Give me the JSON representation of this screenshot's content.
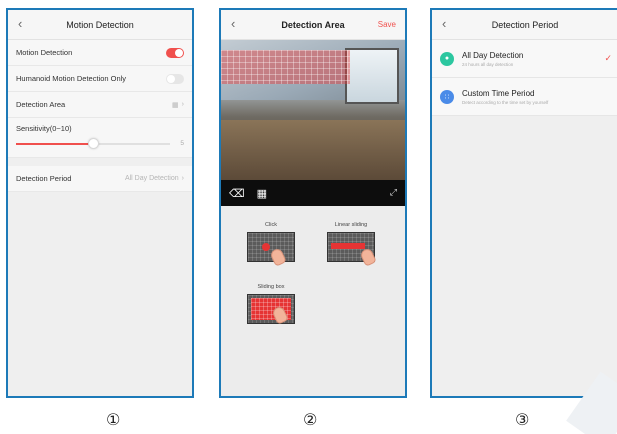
{
  "screen1": {
    "back_icon": "chevron-left",
    "title": "Motion Detection",
    "rows": {
      "motion_detection": "Motion Detection",
      "humanoid": "Humanoid Motion Detection Only",
      "detection_area": "Detection Area"
    },
    "motion_detection_on": true,
    "humanoid_on": false,
    "sensitivity_label": "Sensitivity(0~10)",
    "sensitivity_value": "5",
    "detection_period_label": "Detection Period",
    "detection_period_value": "All Day Detection",
    "accent_color": "#f0504d"
  },
  "screen2": {
    "back_icon": "chevron-left",
    "title": "Detection Area",
    "save_label": "Save",
    "demos": {
      "click": "Click",
      "linear": "Linear sliding",
      "box": "Sliding box"
    }
  },
  "screen3": {
    "back_icon": "chevron-left",
    "title": "Detection Period",
    "options": [
      {
        "title": "All Day Detection",
        "subtitle": "24 hours all day detection",
        "selected": true
      },
      {
        "title": "Custom Time Period",
        "subtitle": "Detect according to the time set by yourself",
        "selected": false
      }
    ]
  },
  "markers": [
    "①",
    "②",
    "③"
  ]
}
